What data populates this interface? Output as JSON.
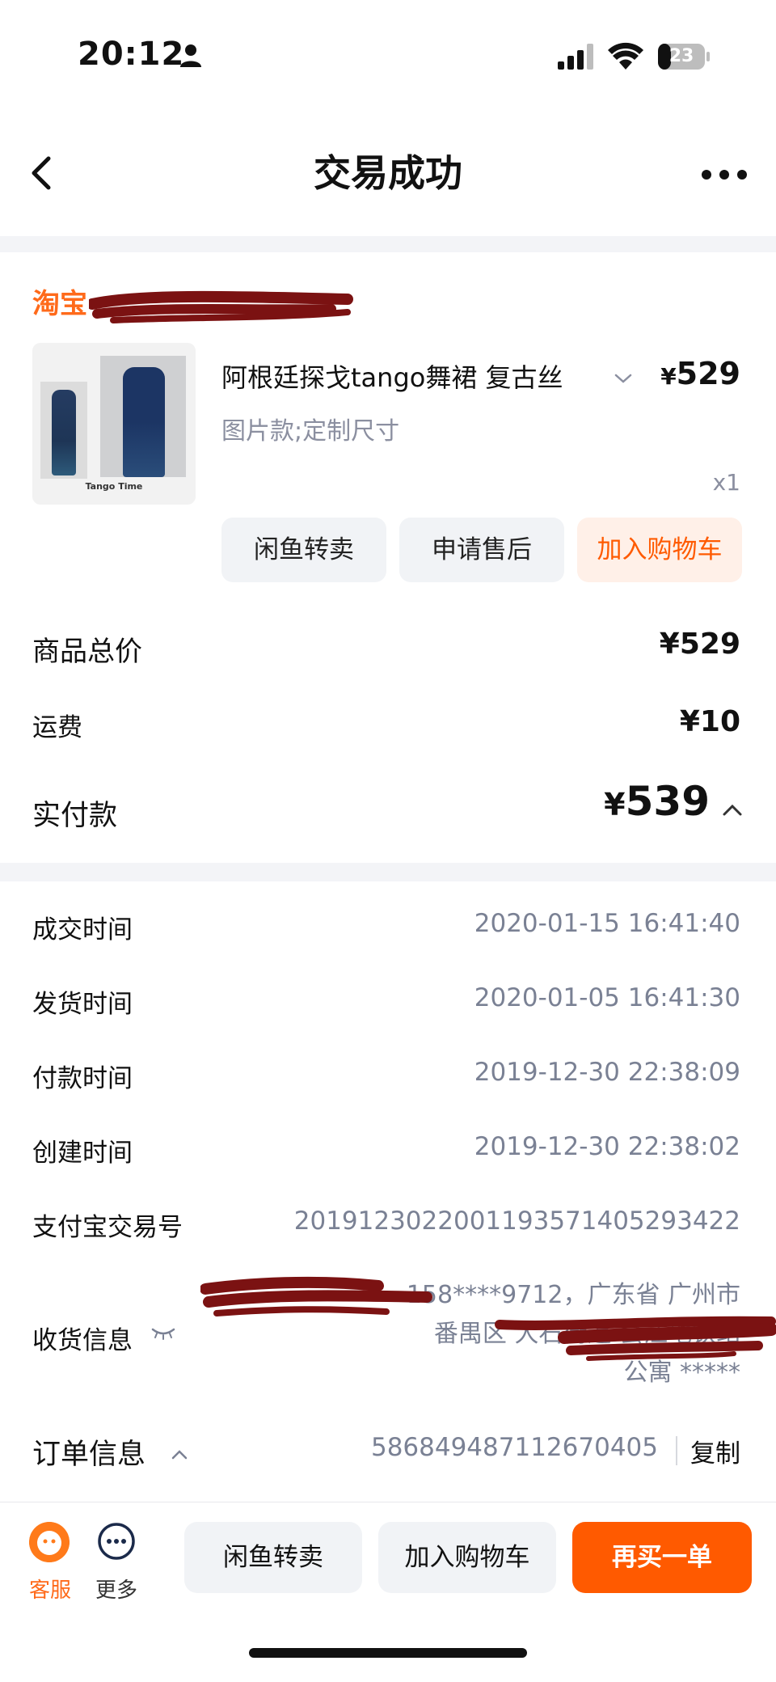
{
  "status_bar": {
    "time": "20:12",
    "battery": "23"
  },
  "nav": {
    "title": "交易成功"
  },
  "shop": {
    "name": "淘宝"
  },
  "product": {
    "title": "阿根廷探戈tango舞裙 复古丝",
    "price": "529",
    "currency": "¥",
    "spec": "图片款;定制尺寸",
    "quantity": "x1",
    "thumbnail_caption": "Tango Time"
  },
  "item_actions": {
    "xianyu": "闲鱼转卖",
    "aftersale": "申请售后",
    "add_cart": "加入购物车"
  },
  "summary": {
    "goods_total_label": "商品总价",
    "goods_total_value": "¥529",
    "shipping_label": "运费",
    "shipping_value": "¥10",
    "paid_label": "实付款",
    "paid_value": "539",
    "currency": "¥"
  },
  "order_info": {
    "rows": [
      {
        "label": "成交时间",
        "value": "2020-01-15 16:41:40"
      },
      {
        "label": "发货时间",
        "value": "2020-01-05 16:41:30"
      },
      {
        "label": "付款时间",
        "value": "2019-12-30 22:38:09"
      },
      {
        "label": "创建时间",
        "value": "2019-12-30 22:38:02"
      },
      {
        "label": "支付宝交易号",
        "value": "2019123022001193571405293422"
      }
    ],
    "address_label": "收货信息",
    "address_line1": "158****9712，广东省 广州市",
    "address_line2": "番禺区 大石街道 会江地铁站",
    "address_line3": "公寓 *****",
    "order_label": "订单信息",
    "order_number": "586849487112670405",
    "copy_label": "复制"
  },
  "bottom_bar": {
    "service_label": "客服",
    "more_label": "更多",
    "btn_xianyu": "闲鱼转卖",
    "btn_cart": "加入购物车",
    "btn_rebuy": "再买一单"
  },
  "colors": {
    "accent": "#ff5a00",
    "muted_text": "#7a8194",
    "background": "#f3f4f7"
  }
}
